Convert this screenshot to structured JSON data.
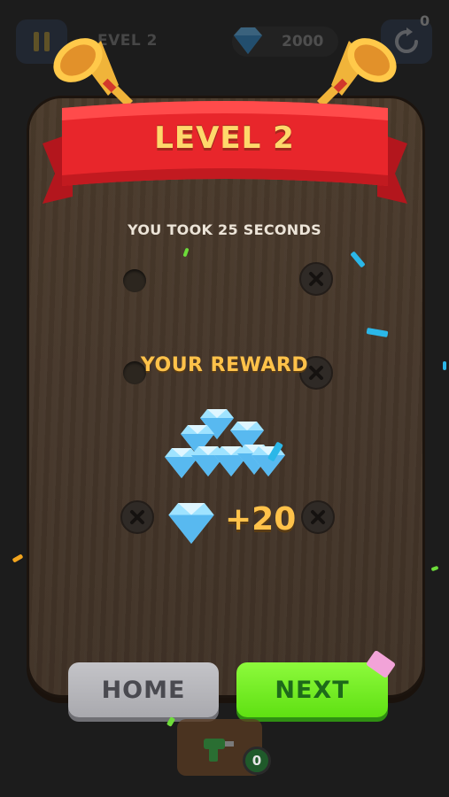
{
  "hud": {
    "level_label": "EVEL 2",
    "gem_count": "2000",
    "restart_count": "0",
    "pause_icon": "pause-icon",
    "restart_icon": "restart-icon"
  },
  "popup": {
    "title": "LEVEL 2",
    "time_text": "YOU TOOK 25 SECONDS",
    "reward_title": "YOUR REWARD",
    "reward_amount": "+20",
    "home_label": "HOME",
    "next_label": "NEXT"
  },
  "booster": {
    "icon": "drill-icon",
    "count": "0"
  },
  "colors": {
    "ribbon": "#e8262b",
    "title_text": "#ffd86b",
    "reward_text": "#ffc24a",
    "board": "#45362a",
    "next_button": "#6cf01e",
    "home_button": "#b4b4b8"
  }
}
